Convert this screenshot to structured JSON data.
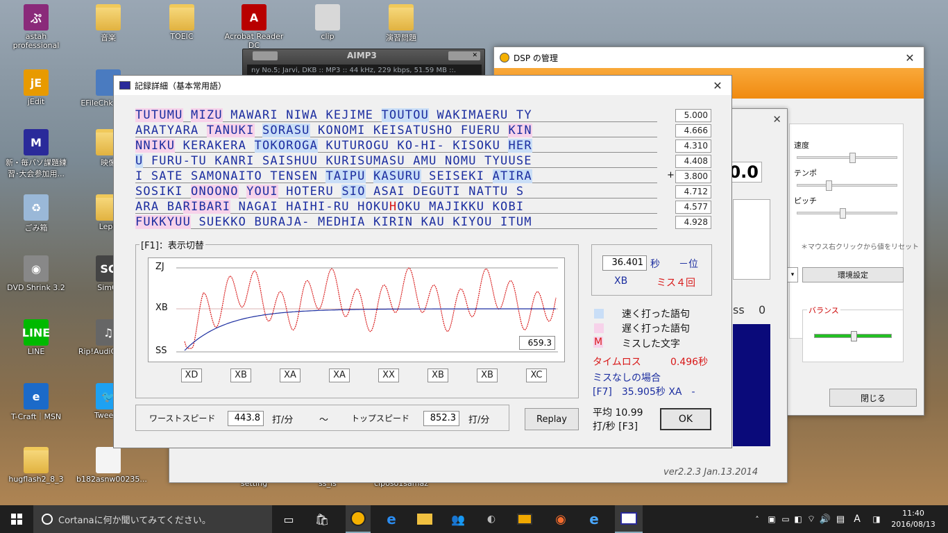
{
  "desktop_icons": [
    {
      "label": "astah professional",
      "glyph": "ぷ",
      "color": "#8a2a7a"
    },
    {
      "label": "音楽",
      "glyph": "",
      "color": ""
    },
    {
      "label": "TOEIC",
      "glyph": "",
      "color": ""
    },
    {
      "label": "Acrobat Reader DC",
      "glyph": "A",
      "color": "#b80000"
    },
    {
      "label": "clip",
      "glyph": "",
      "color": "#d8d8d8"
    },
    {
      "label": "演習問題",
      "glyph": "",
      "color": ""
    },
    {
      "label": "jEdit",
      "glyph": "jE",
      "color": "#e89a00"
    },
    {
      "label": "EFileChk - ット",
      "glyph": "",
      "color": "#4a7bc0"
    },
    {
      "label": "新・毎パソ課題練習･大会参加用...",
      "glyph": "M",
      "color": "#2a2a9a"
    },
    {
      "label": "映像",
      "glyph": "",
      "color": ""
    },
    {
      "label": "ごみ箱",
      "glyph": "♻",
      "color": "#9ab8d8"
    },
    {
      "label": "Leph",
      "glyph": "",
      "color": ""
    },
    {
      "label": "DVD Shrink 3.2",
      "glyph": "◉",
      "color": "#888"
    },
    {
      "label": "SimCi",
      "glyph": "SC",
      "color": "#444"
    },
    {
      "label": "LINE",
      "glyph": "LINE",
      "color": "#00b900"
    },
    {
      "label": "Rip!AudiC Ver 4",
      "glyph": "♫",
      "color": "#666"
    },
    {
      "label": "T-Craft｜MSN",
      "glyph": "e",
      "color": "#1b6ac9"
    },
    {
      "label": "TweetD",
      "glyph": "🐦",
      "color": "#1da1f2"
    },
    {
      "label": "hugflash2_8_3",
      "glyph": "",
      "color": ""
    },
    {
      "label": "b182asnw00235...",
      "glyph": "",
      "color": "#f4f4f4"
    },
    {
      "label": "setting",
      "glyph": "",
      "color": ""
    },
    {
      "label": "ss_ls",
      "glyph": "",
      "color": ""
    },
    {
      "label": "ciposo1samaz",
      "glyph": "",
      "color": ""
    }
  ],
  "aimp": {
    "title": "AIMP3",
    "track": "ny No.5; Jarvi, DKB :: MP3 :: 44 kHz, 229 kbps, 51.59 MB ::."
  },
  "dsp": {
    "title": "DSP の管理",
    "speed": "速度",
    "tempo": "テンポ",
    "pitch": "ピッチ",
    "reset_note": "＊マウス右クリックから値をリセット",
    "settings": "環境設定",
    "balance": "バランス",
    "close": "閉じる",
    "speed_level": 0.55,
    "tempo_level": 0.3,
    "pitch_level": 0.45
  },
  "back_window": {
    "score": "0.0",
    "ss_label": "ss",
    "ss_value": "0",
    "version": "ver2.2.3  Jan.13.2014"
  },
  "dialog": {
    "title": "記録詳細（基本常用語）",
    "lines": [
      {
        "parts": [
          {
            "t": "TUTUMU",
            "c": "s"
          },
          {
            "t": " "
          },
          {
            "t": "MIZU",
            "c": "s"
          },
          {
            "t": " MAWARI NIWA KEJIME "
          },
          {
            "t": "TOUTOU",
            "c": "f"
          },
          {
            "t": " WAKIMAERU TY"
          }
        ],
        "value": "5.000"
      },
      {
        "parts": [
          {
            "t": "ARATYARA "
          },
          {
            "t": "TANUKI",
            "c": "s"
          },
          {
            "t": " "
          },
          {
            "t": "SORASU",
            "c": "f"
          },
          {
            "t": " KONOMI KEISATUSHO FUERU "
          },
          {
            "t": "KIN",
            "c": "s"
          }
        ],
        "value": "4.666"
      },
      {
        "parts": [
          {
            "t": "NNIKU",
            "c": "s"
          },
          {
            "t": " KERAKERA "
          },
          {
            "t": "TOKOROGA",
            "c": "f"
          },
          {
            "t": " KUTUROGU KO-HI- KISOKU "
          },
          {
            "t": "HER",
            "c": "f"
          }
        ],
        "value": "4.310"
      },
      {
        "parts": [
          {
            "t": "U",
            "c": "f"
          },
          {
            "t": " FURU-TU KANRI SAISHUU KURISUMASU AMU NOMU TYUUSE"
          }
        ],
        "value": "4.408"
      },
      {
        "parts": [
          {
            "t": "I SATE SAMONAITO TENSEN "
          },
          {
            "t": "TAIPU",
            "c": "f"
          },
          {
            "t": " "
          },
          {
            "t": "KASURU",
            "c": "f"
          },
          {
            "t": " SEISEKI "
          },
          {
            "t": "ATIRA",
            "c": "f"
          }
        ],
        "value": "3.800",
        "marker": "+"
      },
      {
        "parts": [
          {
            "t": " SOSIKI "
          },
          {
            "t": "ONOONO",
            "c": "s"
          },
          {
            "t": " "
          },
          {
            "t": "YOUI",
            "c": "s"
          },
          {
            "t": " HOTERU "
          },
          {
            "t": "SIO",
            "c": "f"
          },
          {
            "t": " ASAI DEGUTI NATTU S"
          }
        ],
        "value": "4.712"
      },
      {
        "parts": [
          {
            "t": "ARA BA"
          },
          {
            "t": "RIBARI",
            "c": "s"
          },
          {
            "t": " NAGAI HAIHI-RU HOKU"
          },
          {
            "t": "H",
            "c": "m"
          },
          {
            "t": "OKU MAJIKKU KOBI"
          }
        ],
        "value": "4.577"
      },
      {
        "parts": [
          {
            "t": "FUKKYUU",
            "c": "s"
          },
          {
            "t": " SUEKKO BURAJA- MEDHIA KIRIN KAU KIYOU ITUM"
          }
        ],
        "value": "4.928"
      }
    ],
    "graph_group": "[F1]：表示切替",
    "axis": [
      "ZJ",
      "XB",
      "SS"
    ],
    "graph_value": "659.3",
    "grades": [
      "XD",
      "XB",
      "XA",
      "XA",
      "XX",
      "XB",
      "XB",
      "XC"
    ],
    "time": "36.401",
    "sec_unit": "秒",
    "rank": "－位",
    "grade": "XB",
    "miss": "ミス４回",
    "legend_fast": "速く打った語句",
    "legend_slow": "遅く打った語句",
    "legend_miss_mark": "M",
    "legend_miss": "ミスした文字",
    "time_loss_label": "タイムロス",
    "time_loss": "0.496秒",
    "no_miss_label": "ミスなしの場合",
    "no_miss": "[F7]　35.905秒 XA　-",
    "avg": "平均 10.99",
    "avg_unit": "打/秒 [F3]",
    "ok": "OK",
    "worst_label": "ワーストスピード",
    "worst": "443.8",
    "per_min": "打/分",
    "tilde": "～",
    "top_label": "トップスピード",
    "top": "852.3",
    "replay": "Replay"
  },
  "taskbar": {
    "search": "Cortanaに何か聞いてみてください。",
    "ime": "A",
    "time": "11:40",
    "date": "2016/08/13"
  }
}
